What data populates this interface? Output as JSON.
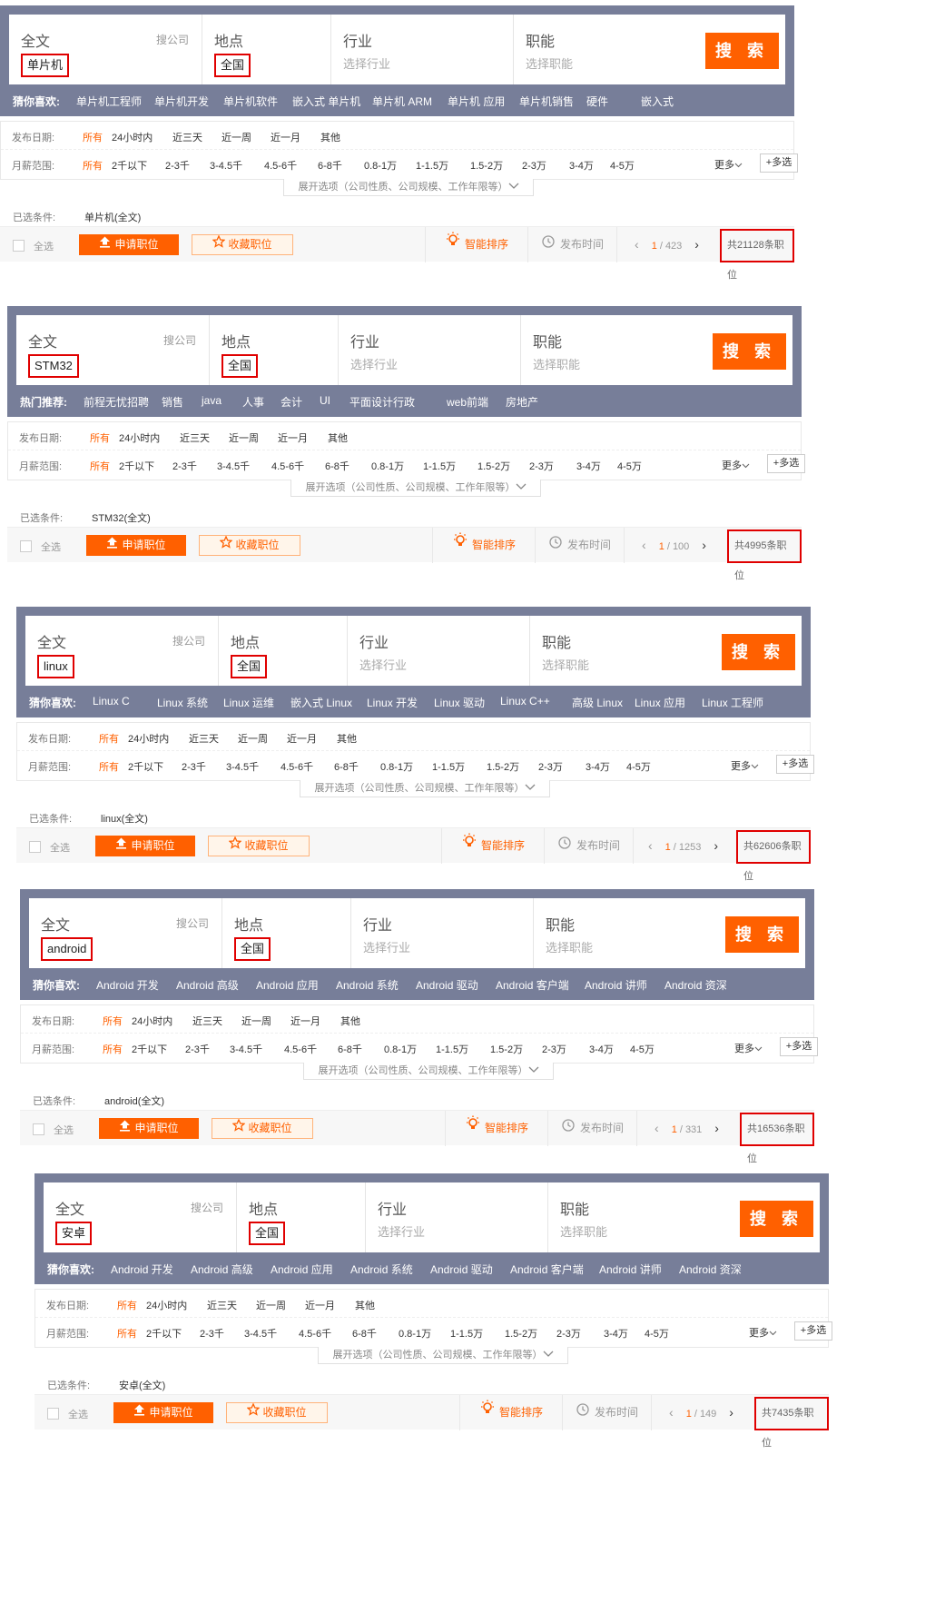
{
  "common": {
    "fulltext_label": "全文",
    "company_search": "搜公司",
    "location_label": "地点",
    "industry_label": "行业",
    "industry_placeholder": "选择行业",
    "function_label": "职能",
    "function_placeholder": "选择职能",
    "search_button": "搜 索",
    "date_label": "发布日期:",
    "date_options": [
      "所有",
      "24小时内",
      "近三天",
      "近一周",
      "近一月",
      "其他"
    ],
    "salary_label": "月薪范围:",
    "salary_options": [
      "所有",
      "2千以下",
      "2-3千",
      "3-4.5千",
      "4.5-6千",
      "6-8千",
      "0.8-1万",
      "1-1.5万",
      "1.5-2万",
      "2-3万",
      "3-4万",
      "4-5万"
    ],
    "more": "更多",
    "multi_select": "多选",
    "expand_options": "展开选项（公司性质、公司规模、工作年限等）",
    "selected_label": "已选条件:",
    "select_all": "全选",
    "apply": "申请职位",
    "favorite": "收藏职位",
    "smart_sort": "智能排序",
    "publish_time": "发布时间",
    "brand_orange": "#ff6000",
    "header_bg": "#777e99",
    "highlight_red": "#e00000"
  },
  "panels": [
    {
      "keyword": "单片机",
      "location": "全国",
      "guess_title": "猜你喜欢:",
      "guess_items": [
        "单片机工程师",
        "单片机开发",
        "单片机软件",
        "嵌入式 单片机",
        "单片机 ARM",
        "单片机 应用",
        "单片机销售",
        "硬件",
        "嵌入式"
      ],
      "selected": "单片机(全文)",
      "page_current": "1",
      "page_total": "/ 423",
      "total": "共21128条职位"
    },
    {
      "keyword": "STM32",
      "location": "全国",
      "guess_title": "热门推荐:",
      "guess_items": [
        "前程无忧招聘",
        "销售",
        "java",
        "人事",
        "会计",
        "UI",
        "平面设计",
        "行政",
        "web前端",
        "房地产"
      ],
      "selected": "STM32(全文)",
      "page_current": "1",
      "page_total": "/ 100",
      "total": "共4995条职位"
    },
    {
      "keyword": "linux",
      "location": "全国",
      "guess_title": "猜你喜欢:",
      "guess_items": [
        "Linux C",
        "Linux 系统",
        "Linux 运维",
        "嵌入式 Linux",
        "Linux 开发",
        "Linux 驱动",
        "Linux C++",
        "高级 Linux",
        "Linux 应用",
        "Linux 工程师"
      ],
      "selected": "linux(全文)",
      "page_current": "1",
      "page_total": "/ 1253",
      "total": "共62606条职位"
    },
    {
      "keyword": "android",
      "location": "全国",
      "guess_title": "猜你喜欢:",
      "guess_items": [
        "Android 开发",
        "Android 高级",
        "Android 应用",
        "Android 系统",
        "Android 驱动",
        "Android 客户端",
        "Android 讲师",
        "Android 资深"
      ],
      "selected": "android(全文)",
      "page_current": "1",
      "page_total": "/ 331",
      "total": "共16536条职位"
    },
    {
      "keyword": "安卓",
      "location": "全国",
      "guess_title": "猜你喜欢:",
      "guess_items": [
        "Android 开发",
        "Android 高级",
        "Android 应用",
        "Android 系统",
        "Android 驱动",
        "Android 客户端",
        "Android 讲师",
        "Android 资深"
      ],
      "selected": "安卓(全文)",
      "page_current": "1",
      "page_total": "/ 149",
      "total": "共7435条职位"
    }
  ]
}
